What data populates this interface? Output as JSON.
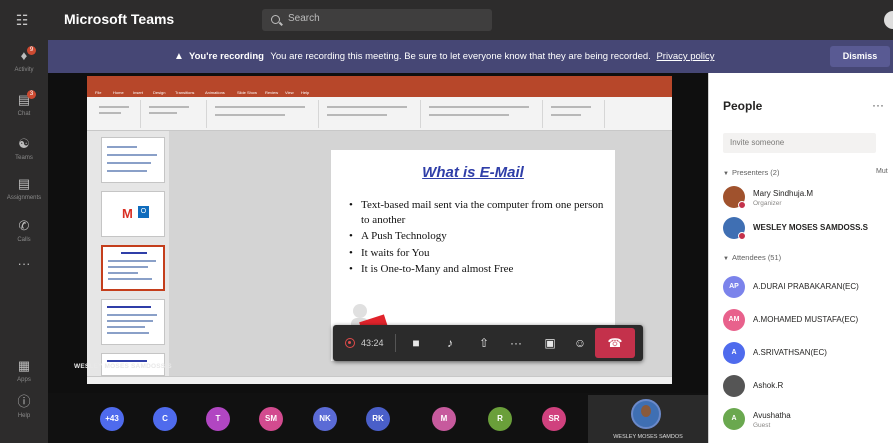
{
  "titlebar": {
    "app_title": "Microsoft Teams",
    "search_placeholder": "Search"
  },
  "rail": {
    "items": [
      {
        "label": "Activity",
        "icon": "bell-icon",
        "badge": "9"
      },
      {
        "label": "Chat",
        "icon": "chat-icon",
        "badge": "3"
      },
      {
        "label": "Teams",
        "icon": "teams-icon"
      },
      {
        "label": "Assignments",
        "icon": "assignments-icon"
      },
      {
        "label": "Calls",
        "icon": "phone-icon"
      },
      {
        "label": "",
        "icon": "more-icon"
      },
      {
        "label": "Apps",
        "icon": "apps-icon"
      },
      {
        "label": "Help",
        "icon": "help-icon"
      }
    ]
  },
  "banner": {
    "bold": "You're recording",
    "text": "You are recording this meeting. Be sure to let everyone know that they are being recorded.",
    "link": "Privacy policy",
    "dismiss": "Dismiss"
  },
  "slide": {
    "title": "What is E-Mail",
    "bullets": [
      "Text-based mail sent via the computer from one person to another",
      "A Push Technology",
      "It waits for You",
      "It is One-to-Many and almost Free"
    ]
  },
  "ppt": {
    "tabs": [
      "File",
      "Home",
      "Insert",
      "Design",
      "Transitions",
      "Animations",
      "Slide Show",
      "Review",
      "View",
      "Help"
    ]
  },
  "presenter_caption": "WESLEY MOSES SAMDOSS.S",
  "controls": {
    "timer": "43:24",
    "hangup_color": "#c4314b"
  },
  "strip": {
    "overflow": "+43",
    "participants": [
      {
        "initials": "C",
        "color": "#4f6bed"
      },
      {
        "initials": "T",
        "color": "#b146c2"
      },
      {
        "initials": "SM",
        "color": "#d34b8f"
      },
      {
        "initials": "NK",
        "color": "#5b6bd6"
      },
      {
        "initials": "RK",
        "color": "#4a5fc9"
      },
      {
        "initials": "M",
        "color": "#c75a9d"
      },
      {
        "initials": "R",
        "color": "#6a9f3a"
      },
      {
        "initials": "SR",
        "color": "#d0417e"
      }
    ],
    "self_name": "WESLEY MOSES SAMDOS"
  },
  "people": {
    "title": "People",
    "invite_placeholder": "Invite someone",
    "presenters_label": "Presenters (2)",
    "mute_all": "Mut",
    "presenters": [
      {
        "name": "Mary Sindhuja.M",
        "role": "Organizer",
        "color": "#a0522d",
        "initials": ""
      },
      {
        "name": "WESLEY MOSES SAMDOSS.S",
        "role": "",
        "color": "#3f6fb3",
        "initials": ""
      }
    ],
    "attendees_label": "Attendees (51)",
    "attendees": [
      {
        "name": "A.DURAI PRABAKARAN(EC)",
        "role": "",
        "color": "#7b83eb",
        "initials": "AP"
      },
      {
        "name": "A.MOHAMED MUSTAFA(EC)",
        "role": "",
        "color": "#e8618c",
        "initials": "AM"
      },
      {
        "name": "A.SRIVATHSAN(EC)",
        "role": "",
        "color": "#4f6bed",
        "initials": "A"
      },
      {
        "name": "Ashok.R",
        "role": "",
        "color": "#555555",
        "initials": ""
      },
      {
        "name": "Avushatha",
        "role": "Guest",
        "color": "#6aa84f",
        "initials": "A"
      }
    ]
  }
}
